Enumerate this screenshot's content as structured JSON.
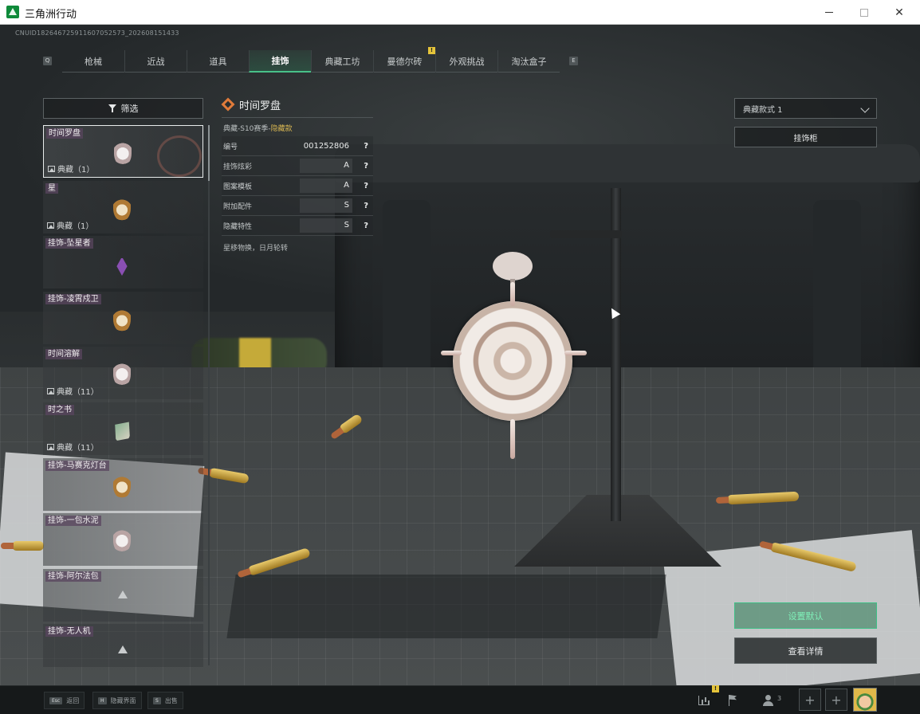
{
  "window": {
    "title": "三角洲行动"
  },
  "uid": "CNUID182646725911607052573_202608151433",
  "nav_left_key": "Q",
  "nav_right_key": "E",
  "tabs": [
    {
      "label": "枪械"
    },
    {
      "label": "近战"
    },
    {
      "label": "道具"
    },
    {
      "label": "挂饰",
      "active": true
    },
    {
      "label": "典藏工坊"
    },
    {
      "label": "曼德尔砖",
      "badge": "!"
    },
    {
      "label": "外观挑战"
    },
    {
      "label": "淘汰盒子"
    }
  ],
  "filter": {
    "label": "筛选"
  },
  "list": [
    {
      "name": "时间罗盘",
      "count": "典藏（1）",
      "selected": true
    },
    {
      "name": "星",
      "count": "典藏（1）"
    },
    {
      "name": "挂饰-坠星者",
      "count": ""
    },
    {
      "name": "挂饰-凌霄戍卫",
      "count": ""
    },
    {
      "name": "时间溶解",
      "count": "典藏（11）"
    },
    {
      "name": "时之书",
      "count": "典藏（11）"
    },
    {
      "name": "挂饰-马赛克灯台",
      "count": ""
    },
    {
      "name": "挂饰-一包水泥",
      "count": ""
    },
    {
      "name": "挂饰-阿尔法包",
      "count": ""
    },
    {
      "name": "挂饰-无人机",
      "count": ""
    }
  ],
  "detail": {
    "name": "时间罗盘",
    "season_prefix": "典藏-S10赛季-",
    "season_tag": "隐藏款",
    "rows": [
      {
        "label": "编号",
        "value": "001252806"
      },
      {
        "label": "挂饰炫彩",
        "value": "A"
      },
      {
        "label": "图案模板",
        "value": "A"
      },
      {
        "label": "附加配件",
        "value": "S"
      },
      {
        "label": "隐藏特性",
        "value": "S"
      }
    ],
    "help": "?",
    "description": "星移物换，日月轮转"
  },
  "style_select": {
    "value": "典藏款式 1"
  },
  "buttons": {
    "cabinet": "挂饰柜",
    "set_default": "设置默认",
    "view_details": "查看详情"
  },
  "bottom": {
    "hints": [
      {
        "key": "Esc",
        "label": "返回"
      },
      {
        "key": "H",
        "label": "隐藏界面"
      },
      {
        "key": "S",
        "label": "出售"
      }
    ],
    "badge": "!",
    "friends_count": "3",
    "slot_plus": "+"
  },
  "colors": {
    "accent_green": "#48c089",
    "badge_yellow": "#e5c43a",
    "season_gold": "#d8b652"
  }
}
